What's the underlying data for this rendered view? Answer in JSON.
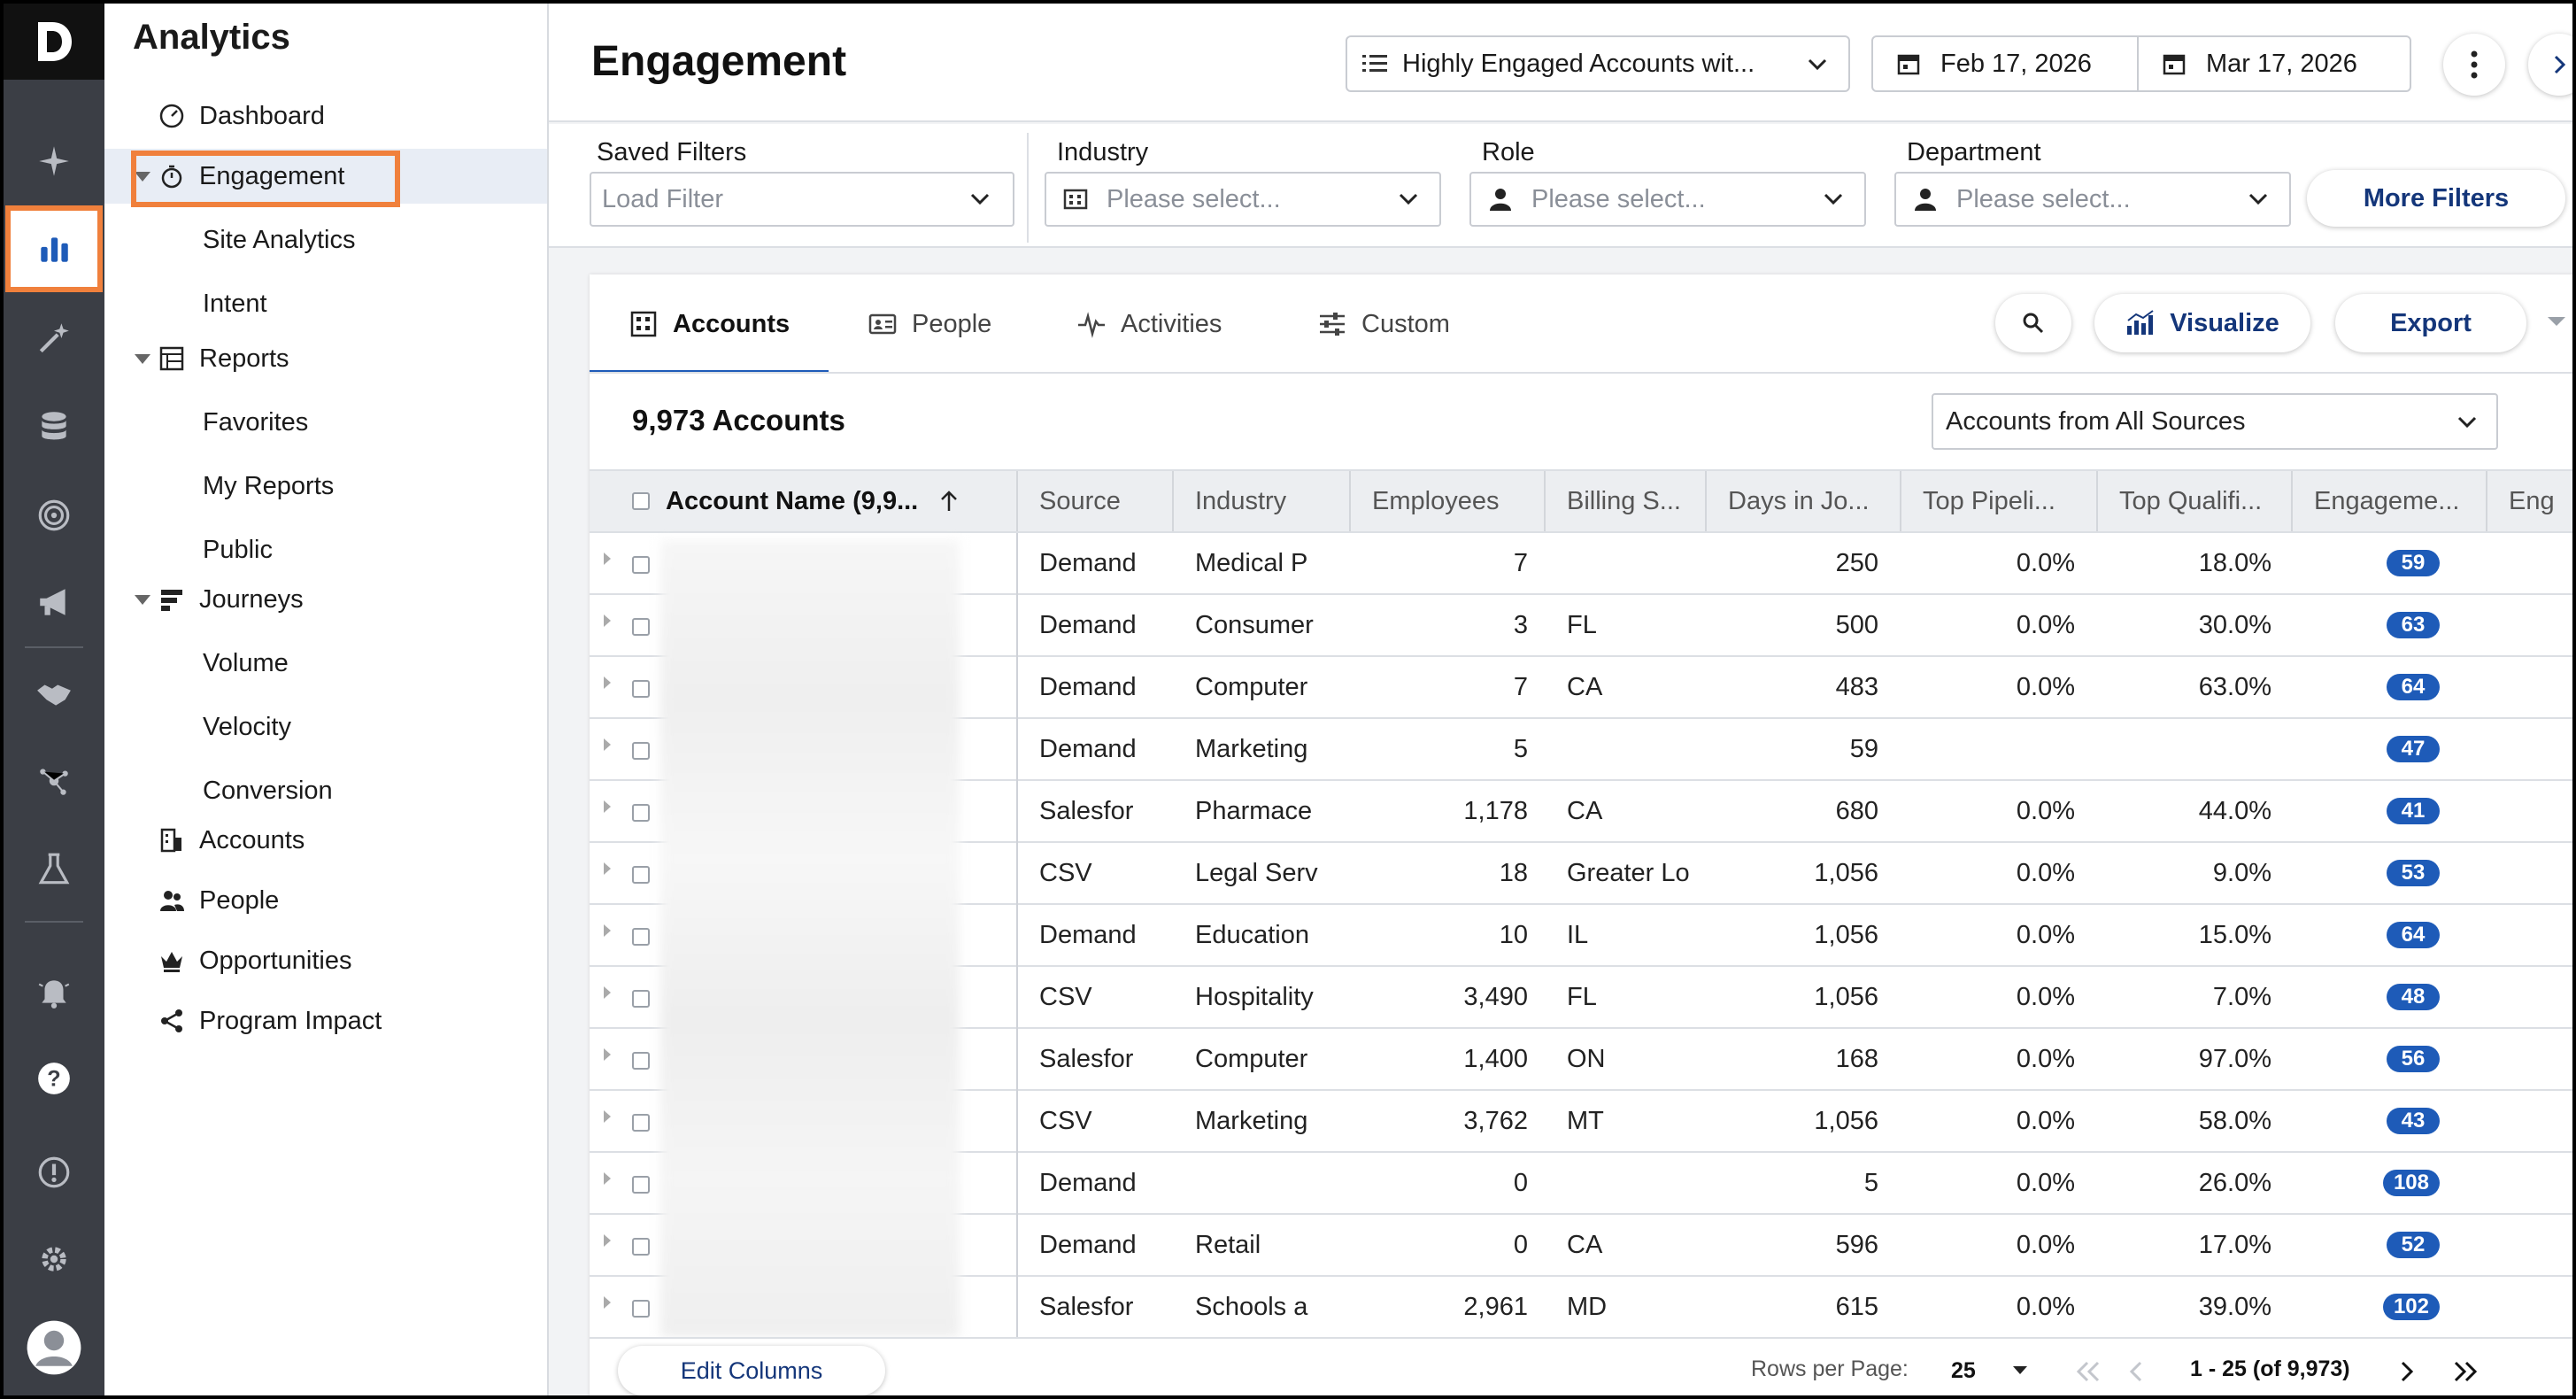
{
  "colors": {
    "accent": "#1e5bb8",
    "highlight": "#f0803c",
    "rail": "#3b3e45"
  },
  "rail": {
    "logo": "D",
    "icons": [
      "sparkle-icon",
      "bar-chart-icon",
      "magic-wand-icon",
      "database-icon",
      "target-icon",
      "megaphone-icon",
      "handshake-icon",
      "network-icon",
      "flask-icon",
      "alarm-bell-icon",
      "help-icon",
      "alert-icon",
      "gear-icon",
      "user-avatar-icon"
    ]
  },
  "nav": {
    "title": "Analytics",
    "items": [
      {
        "label": "Dashboard"
      },
      {
        "label": "Engagement"
      },
      {
        "label": "Site Analytics"
      },
      {
        "label": "Intent"
      },
      {
        "label": "Reports"
      },
      {
        "label": "Favorites"
      },
      {
        "label": "My Reports"
      },
      {
        "label": "Public"
      },
      {
        "label": "Journeys"
      },
      {
        "label": "Volume"
      },
      {
        "label": "Velocity"
      },
      {
        "label": "Conversion"
      },
      {
        "label": "Accounts"
      },
      {
        "label": "People"
      },
      {
        "label": "Opportunities"
      },
      {
        "label": "Program Impact"
      }
    ]
  },
  "header": {
    "title": "Engagement",
    "segment": "Highly Engaged Accounts wit...",
    "start_date": "Feb 17, 2026",
    "end_date": "Mar 17, 2026"
  },
  "filters": {
    "saved": {
      "label": "Saved Filters",
      "placeholder": "Load Filter"
    },
    "industry": {
      "label": "Industry",
      "placeholder": "Please select..."
    },
    "role": {
      "label": "Role",
      "placeholder": "Please select..."
    },
    "department": {
      "label": "Department",
      "placeholder": "Please select..."
    },
    "more": "More Filters"
  },
  "tabs": [
    "Accounts",
    "People",
    "Activities",
    "Custom"
  ],
  "actions": {
    "visualize": "Visualize",
    "export": "Export"
  },
  "summary": {
    "count": "9,973 Accounts",
    "source": "Accounts from All Sources"
  },
  "table": {
    "columns": [
      "Account Name (9,9...",
      "Source",
      "Industry",
      "Employees",
      "Billing S...",
      "Days in Jo...",
      "Top Pipeli...",
      "Top Qualifi...",
      "Engageme...",
      "Eng"
    ],
    "rows": [
      [
        "Demand",
        "Medical P",
        "7",
        "",
        "250",
        "0.0%",
        "18.0%",
        "59"
      ],
      [
        "Demand",
        "Consumer",
        "3",
        "FL",
        "500",
        "0.0%",
        "30.0%",
        "63"
      ],
      [
        "Demand",
        "Computer",
        "7",
        "CA",
        "483",
        "0.0%",
        "63.0%",
        "64"
      ],
      [
        "Demand",
        "Marketing",
        "5",
        "",
        "59",
        "",
        "",
        "47"
      ],
      [
        "Salesfor",
        "Pharmace",
        "1,178",
        "CA",
        "680",
        "0.0%",
        "44.0%",
        "41"
      ],
      [
        "CSV",
        "Legal Serv",
        "18",
        "Greater Lo",
        "1,056",
        "0.0%",
        "9.0%",
        "53"
      ],
      [
        "Demand",
        "Education",
        "10",
        "IL",
        "1,056",
        "0.0%",
        "15.0%",
        "64"
      ],
      [
        "CSV",
        "Hospitality",
        "3,490",
        "FL",
        "1,056",
        "0.0%",
        "7.0%",
        "48"
      ],
      [
        "Salesfor",
        "Computer",
        "1,400",
        "ON",
        "168",
        "0.0%",
        "97.0%",
        "56"
      ],
      [
        "CSV",
        "Marketing",
        "3,762",
        "MT",
        "1,056",
        "0.0%",
        "58.0%",
        "43"
      ],
      [
        "Demand",
        "",
        "0",
        "",
        "5",
        "0.0%",
        "26.0%",
        "108"
      ],
      [
        "Demand",
        "Retail",
        "0",
        "CA",
        "596",
        "0.0%",
        "17.0%",
        "52"
      ],
      [
        "Salesfor",
        "Schools a",
        "2,961",
        "MD",
        "615",
        "0.0%",
        "39.0%",
        "102"
      ]
    ]
  },
  "footer": {
    "edit_columns": "Edit Columns",
    "rows_per_page_label": "Rows per Page:",
    "rows_per_page": "25",
    "range": "1 - 25 (of 9,973)"
  }
}
